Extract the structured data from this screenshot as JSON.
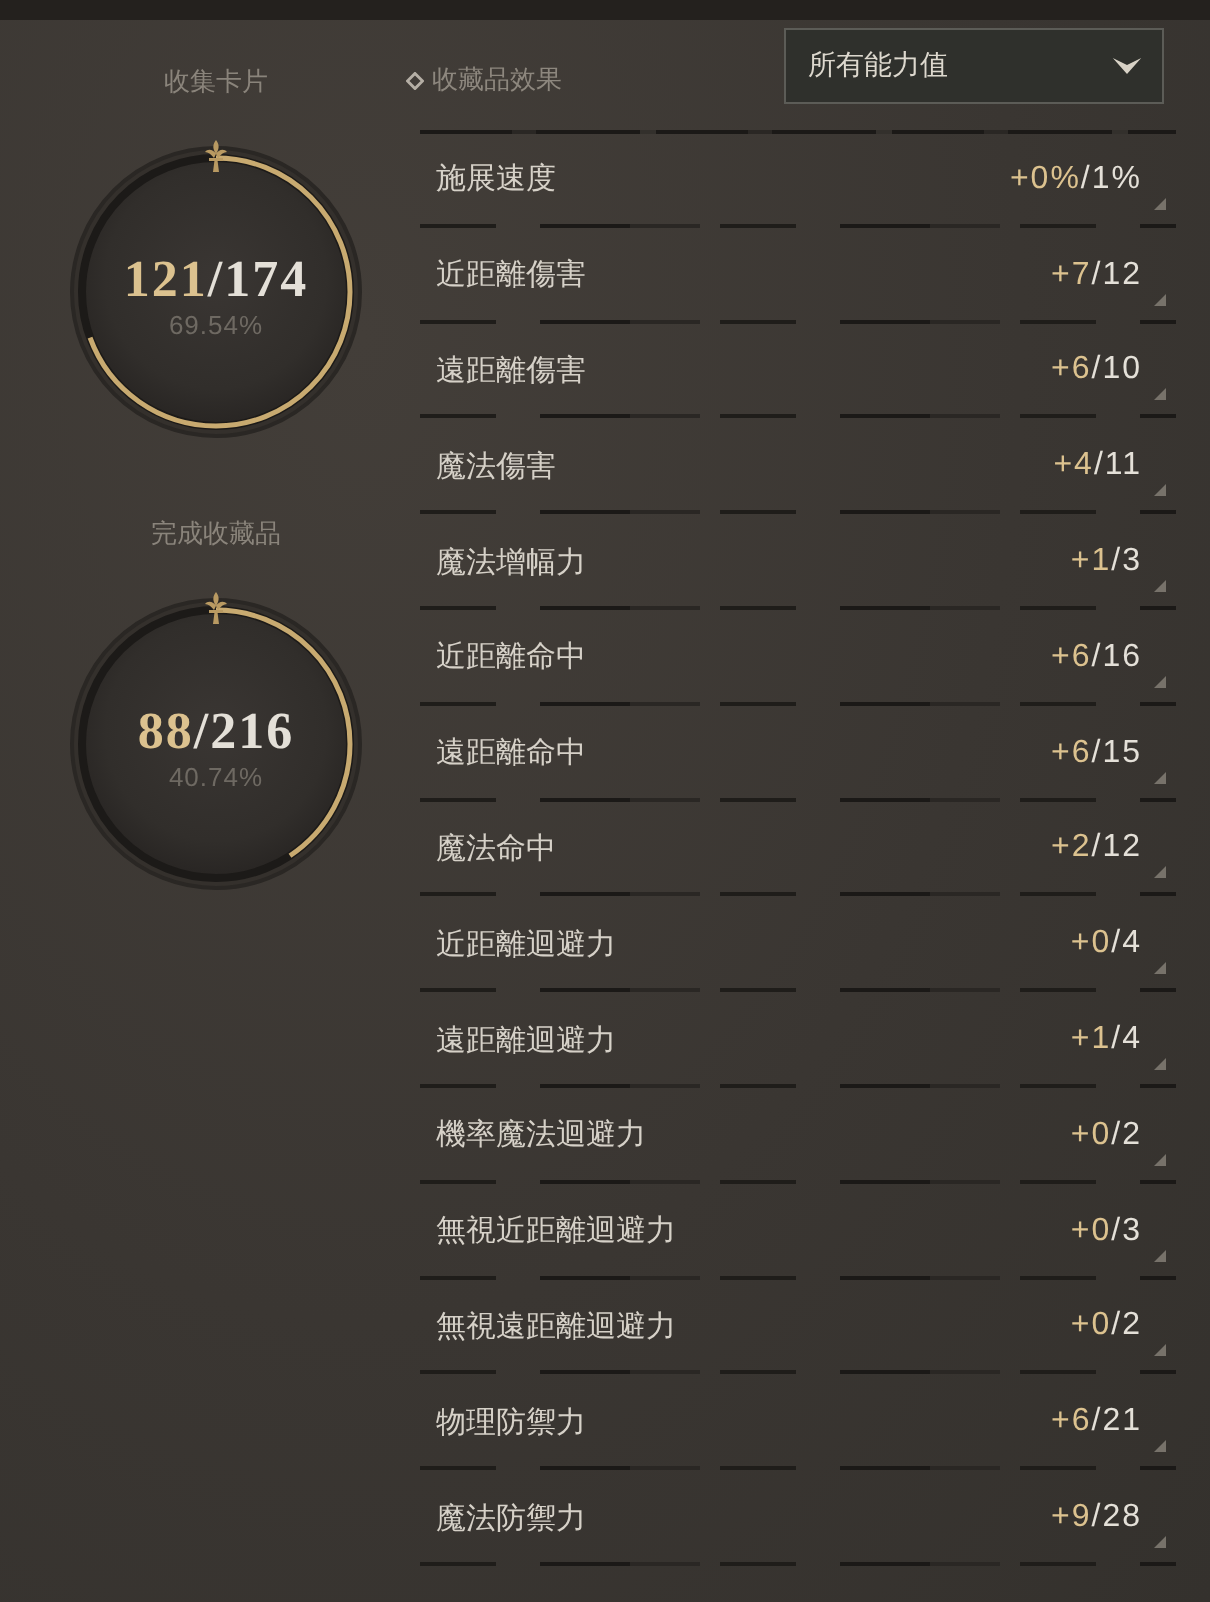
{
  "collection_summary": [
    {
      "label": "收集卡片",
      "collected": "121",
      "total": "/174",
      "percent": "69.54%",
      "level": 0.6954
    },
    {
      "label": "完成收藏品",
      "collected": "88",
      "total": "/216",
      "percent": "40.74%",
      "level": 0.4074
    }
  ],
  "effects": {
    "title": "收藏品效果",
    "filter_dropdown": {
      "value": "所有能力值"
    },
    "rows": [
      {
        "name": "施展速度",
        "gained": "+0%",
        "max": "/1%"
      },
      {
        "name": "近距離傷害",
        "gained": "+7",
        "max": "/12"
      },
      {
        "name": "遠距離傷害",
        "gained": "+6",
        "max": "/10"
      },
      {
        "name": "魔法傷害",
        "gained": "+4",
        "max": "/11"
      },
      {
        "name": "魔法增幅力",
        "gained": "+1",
        "max": "/3"
      },
      {
        "name": "近距離命中",
        "gained": "+6",
        "max": "/16"
      },
      {
        "name": "遠距離命中",
        "gained": "+6",
        "max": "/15"
      },
      {
        "name": "魔法命中",
        "gained": "+2",
        "max": "/12"
      },
      {
        "name": "近距離迴避力",
        "gained": "+0",
        "max": "/4"
      },
      {
        "name": "遠距離迴避力",
        "gained": "+1",
        "max": "/4"
      },
      {
        "name": "機率魔法迴避力",
        "gained": "+0",
        "max": "/2"
      },
      {
        "name": "無視近距離迴避力",
        "gained": "+0",
        "max": "/3"
      },
      {
        "name": "無視遠距離迴避力",
        "gained": "+0",
        "max": "/2"
      },
      {
        "name": "物理防禦力",
        "gained": "+6",
        "max": "/21"
      },
      {
        "name": "魔法防禦力",
        "gained": "+9",
        "max": "/28"
      }
    ]
  }
}
